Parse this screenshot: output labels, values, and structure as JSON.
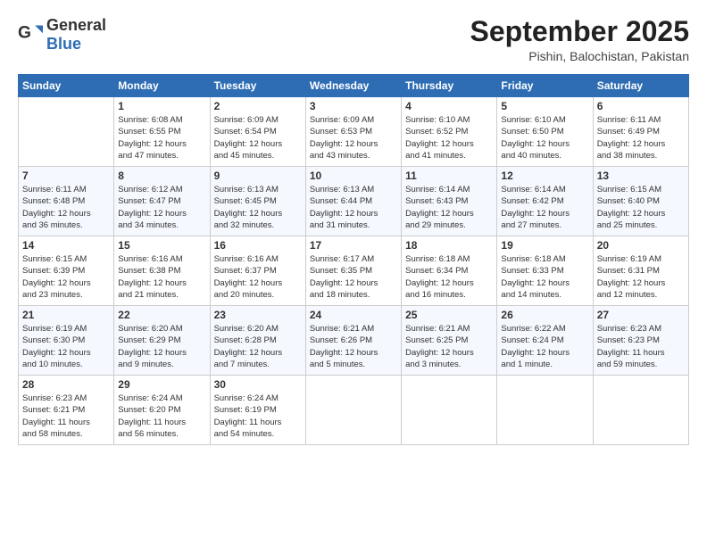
{
  "header": {
    "logo_general": "General",
    "logo_blue": "Blue",
    "title": "September 2025",
    "location": "Pishin, Balochistan, Pakistan"
  },
  "columns": [
    "Sunday",
    "Monday",
    "Tuesday",
    "Wednesday",
    "Thursday",
    "Friday",
    "Saturday"
  ],
  "weeks": [
    [
      {
        "day": "",
        "info": ""
      },
      {
        "day": "1",
        "info": "Sunrise: 6:08 AM\nSunset: 6:55 PM\nDaylight: 12 hours\nand 47 minutes."
      },
      {
        "day": "2",
        "info": "Sunrise: 6:09 AM\nSunset: 6:54 PM\nDaylight: 12 hours\nand 45 minutes."
      },
      {
        "day": "3",
        "info": "Sunrise: 6:09 AM\nSunset: 6:53 PM\nDaylight: 12 hours\nand 43 minutes."
      },
      {
        "day": "4",
        "info": "Sunrise: 6:10 AM\nSunset: 6:52 PM\nDaylight: 12 hours\nand 41 minutes."
      },
      {
        "day": "5",
        "info": "Sunrise: 6:10 AM\nSunset: 6:50 PM\nDaylight: 12 hours\nand 40 minutes."
      },
      {
        "day": "6",
        "info": "Sunrise: 6:11 AM\nSunset: 6:49 PM\nDaylight: 12 hours\nand 38 minutes."
      }
    ],
    [
      {
        "day": "7",
        "info": "Sunrise: 6:11 AM\nSunset: 6:48 PM\nDaylight: 12 hours\nand 36 minutes."
      },
      {
        "day": "8",
        "info": "Sunrise: 6:12 AM\nSunset: 6:47 PM\nDaylight: 12 hours\nand 34 minutes."
      },
      {
        "day": "9",
        "info": "Sunrise: 6:13 AM\nSunset: 6:45 PM\nDaylight: 12 hours\nand 32 minutes."
      },
      {
        "day": "10",
        "info": "Sunrise: 6:13 AM\nSunset: 6:44 PM\nDaylight: 12 hours\nand 31 minutes."
      },
      {
        "day": "11",
        "info": "Sunrise: 6:14 AM\nSunset: 6:43 PM\nDaylight: 12 hours\nand 29 minutes."
      },
      {
        "day": "12",
        "info": "Sunrise: 6:14 AM\nSunset: 6:42 PM\nDaylight: 12 hours\nand 27 minutes."
      },
      {
        "day": "13",
        "info": "Sunrise: 6:15 AM\nSunset: 6:40 PM\nDaylight: 12 hours\nand 25 minutes."
      }
    ],
    [
      {
        "day": "14",
        "info": "Sunrise: 6:15 AM\nSunset: 6:39 PM\nDaylight: 12 hours\nand 23 minutes."
      },
      {
        "day": "15",
        "info": "Sunrise: 6:16 AM\nSunset: 6:38 PM\nDaylight: 12 hours\nand 21 minutes."
      },
      {
        "day": "16",
        "info": "Sunrise: 6:16 AM\nSunset: 6:37 PM\nDaylight: 12 hours\nand 20 minutes."
      },
      {
        "day": "17",
        "info": "Sunrise: 6:17 AM\nSunset: 6:35 PM\nDaylight: 12 hours\nand 18 minutes."
      },
      {
        "day": "18",
        "info": "Sunrise: 6:18 AM\nSunset: 6:34 PM\nDaylight: 12 hours\nand 16 minutes."
      },
      {
        "day": "19",
        "info": "Sunrise: 6:18 AM\nSunset: 6:33 PM\nDaylight: 12 hours\nand 14 minutes."
      },
      {
        "day": "20",
        "info": "Sunrise: 6:19 AM\nSunset: 6:31 PM\nDaylight: 12 hours\nand 12 minutes."
      }
    ],
    [
      {
        "day": "21",
        "info": "Sunrise: 6:19 AM\nSunset: 6:30 PM\nDaylight: 12 hours\nand 10 minutes."
      },
      {
        "day": "22",
        "info": "Sunrise: 6:20 AM\nSunset: 6:29 PM\nDaylight: 12 hours\nand 9 minutes."
      },
      {
        "day": "23",
        "info": "Sunrise: 6:20 AM\nSunset: 6:28 PM\nDaylight: 12 hours\nand 7 minutes."
      },
      {
        "day": "24",
        "info": "Sunrise: 6:21 AM\nSunset: 6:26 PM\nDaylight: 12 hours\nand 5 minutes."
      },
      {
        "day": "25",
        "info": "Sunrise: 6:21 AM\nSunset: 6:25 PM\nDaylight: 12 hours\nand 3 minutes."
      },
      {
        "day": "26",
        "info": "Sunrise: 6:22 AM\nSunset: 6:24 PM\nDaylight: 12 hours\nand 1 minute."
      },
      {
        "day": "27",
        "info": "Sunrise: 6:23 AM\nSunset: 6:23 PM\nDaylight: 11 hours\nand 59 minutes."
      }
    ],
    [
      {
        "day": "28",
        "info": "Sunrise: 6:23 AM\nSunset: 6:21 PM\nDaylight: 11 hours\nand 58 minutes."
      },
      {
        "day": "29",
        "info": "Sunrise: 6:24 AM\nSunset: 6:20 PM\nDaylight: 11 hours\nand 56 minutes."
      },
      {
        "day": "30",
        "info": "Sunrise: 6:24 AM\nSunset: 6:19 PM\nDaylight: 11 hours\nand 54 minutes."
      },
      {
        "day": "",
        "info": ""
      },
      {
        "day": "",
        "info": ""
      },
      {
        "day": "",
        "info": ""
      },
      {
        "day": "",
        "info": ""
      }
    ]
  ]
}
